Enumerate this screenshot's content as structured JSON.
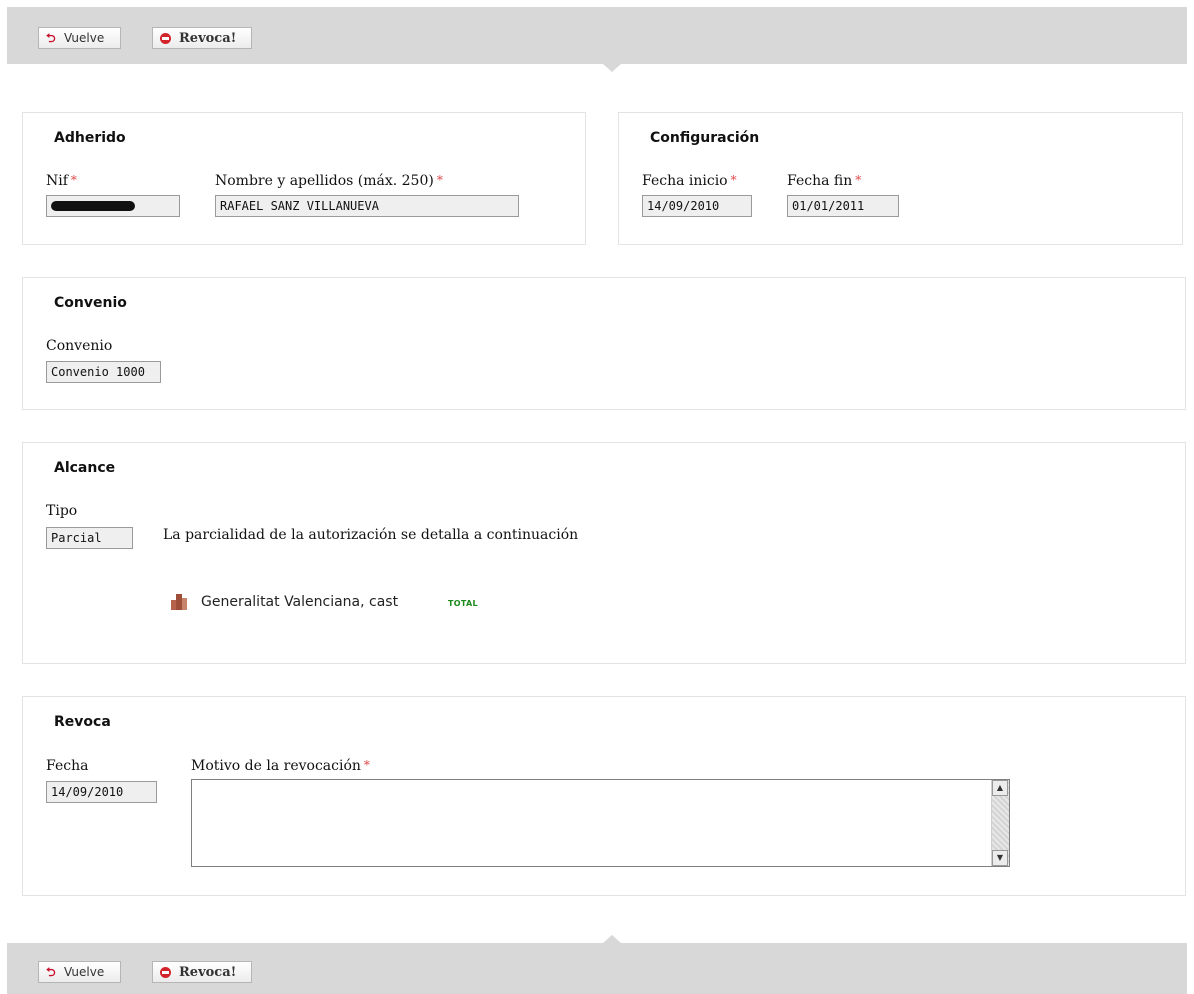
{
  "toolbar": {
    "back_label": "Vuelve",
    "revoke_label": "Revoca!"
  },
  "adherido": {
    "title": "Adherido",
    "nif_label": "Nif",
    "nombre_label": "Nombre y apellidos (máx. 250)",
    "nombre_value": "RAFAEL SANZ VILLANUEVA"
  },
  "configuracion": {
    "title": "Configuración",
    "fecha_inicio_label": "Fecha inicio",
    "fecha_inicio_value": "14/09/2010",
    "fecha_fin_label": "Fecha fin",
    "fecha_fin_value": "01/01/2011"
  },
  "convenio": {
    "title": "Convenio",
    "field_label": "Convenio",
    "field_value": "Convenio 1000"
  },
  "alcance": {
    "title": "Alcance",
    "tipo_label": "Tipo",
    "tipo_value": "Parcial",
    "description": "La parcialidad de la autorización se detalla a continuación",
    "entity_name": "Generalitat Valenciana, cast",
    "entity_badge": "TOTAL",
    "entity_icon": "building-icon"
  },
  "revoca": {
    "title": "Revoca",
    "fecha_label": "Fecha",
    "fecha_value": "14/09/2010",
    "motivo_label": "Motivo de la revocación",
    "motivo_value": ""
  },
  "required_mark": "*",
  "colors": {
    "required": "#e04848",
    "toolbar": "#d8d8d8",
    "badge": "#1a8a1a"
  }
}
